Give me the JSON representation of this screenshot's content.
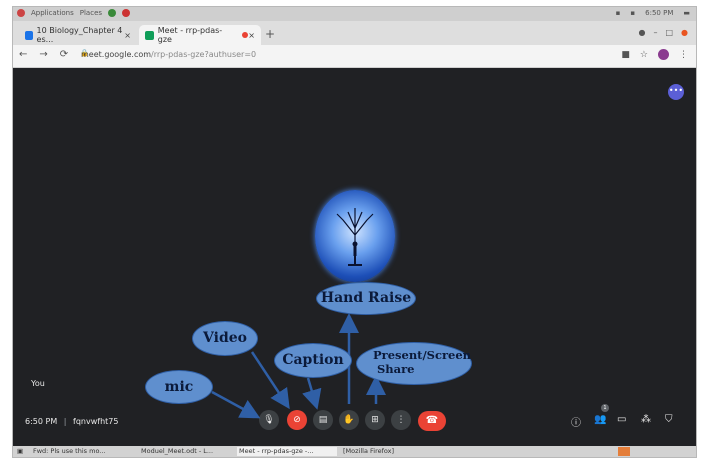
{
  "system_bar": {
    "applications": "Applications",
    "places": "Places",
    "clock": "6:50 PM"
  },
  "tabs": [
    {
      "label": "10 Biology_Chapter 4 es...",
      "close": "×",
      "active": false
    },
    {
      "label": "Meet - rrp-pdas-gze",
      "close": "×",
      "active": true
    }
  ],
  "new_tab": "+",
  "address": {
    "host": "meet.google.com",
    "path": "/rrp-pdas-gze?authuser=0"
  },
  "meet": {
    "self_label": "You",
    "time": "6:50 PM",
    "separator": "|",
    "meeting_code": "fqnvwfht75",
    "participant_count": "1"
  },
  "annotations": {
    "mic": "mic",
    "video": "Video",
    "caption": "Caption",
    "hand_raise": "Hand Raise",
    "present_line1": "Present/Screen",
    "present_line2": "Share"
  },
  "taskbar": [
    {
      "label": "Fwd: Pls use this mo...",
      "active": false
    },
    {
      "label": "Moduel_Meet.odt - L...",
      "active": false
    },
    {
      "label": "Meet - rrp-pdas-gze -...",
      "active": true
    },
    {
      "label": "[Mozilla Firefox]",
      "active": false
    }
  ],
  "colors": {
    "meet_bg": "#202124",
    "danger": "#ea4335",
    "callout": "#5f8fce",
    "arrow": "#2f5fa6"
  }
}
